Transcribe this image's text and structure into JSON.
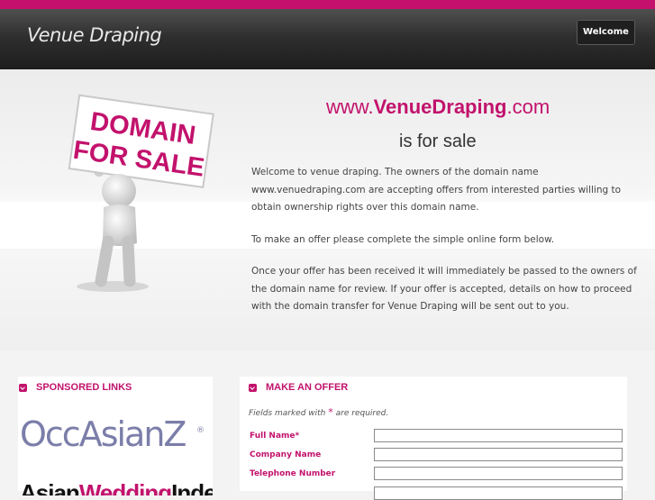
{
  "header": {
    "logo": "Venue Draping",
    "welcome_button": "Welcome"
  },
  "hero": {
    "domain_prefix": "www.",
    "domain_name": "VenueDraping",
    "domain_suffix": ".com",
    "for_sale": "is for sale",
    "sign_line1": "DOMAIN",
    "sign_line2": "FOR SALE",
    "paragraphs": [
      "Welcome to venue draping. The owners of the domain name www.venuedraping.com are accepting offers from interested parties willing to obtain ownership rights over this domain name.",
      "To make an offer please complete the simple online form below.",
      "Once your offer has been received it will immediately be passed to the owners of the domain name for review. If your offer is accepted, details on how to proceed with the domain transfer for Venue Draping will be sent out to you."
    ]
  },
  "sponsored": {
    "heading": "SPONSORED LINKS",
    "ads": [
      {
        "name": "OccAsianZ",
        "mark": "®"
      },
      {
        "name_part1": "Asian",
        "name_part2": "Wedding",
        "name_part3": "Index"
      }
    ]
  },
  "offer": {
    "heading": "MAKE AN OFFER",
    "note_prefix": "Fields marked with",
    "note_star": "*",
    "note_suffix": "are required.",
    "fields": [
      {
        "label": "Full Name*",
        "value": ""
      },
      {
        "label": "Company Name",
        "value": ""
      },
      {
        "label": "Telephone Number",
        "value": ""
      }
    ]
  },
  "colors": {
    "accent": "#c2126c",
    "header_dark": "#2f2f2f",
    "text": "#444444"
  }
}
